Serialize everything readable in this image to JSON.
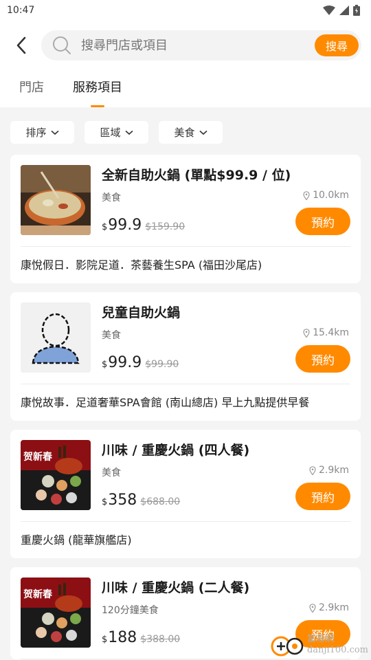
{
  "status": {
    "time": "10:47"
  },
  "search": {
    "placeholder": "搜尋門店或項目",
    "button_label": "搜尋"
  },
  "tabs": [
    {
      "label": "門店",
      "active": false
    },
    {
      "label": "服務項目",
      "active": true
    }
  ],
  "filters": [
    {
      "label": "排序"
    },
    {
      "label": "區域"
    },
    {
      "label": "美食"
    }
  ],
  "cards": [
    {
      "title": "全新自助火鍋 (單點$99.9 / 位)",
      "category": "美食",
      "distance": "10.0km",
      "currency": "$",
      "price": "99.9",
      "original_price": "$159.90",
      "book_label": "預約",
      "store": "康悅假日．影院足道．茶藝養生SPA (福田沙尾店)"
    },
    {
      "title": "兒童自助火鍋",
      "category": "美食",
      "distance": "15.4km",
      "currency": "$",
      "price": "99.9",
      "original_price": "$99.90",
      "book_label": "預約",
      "store": "康悅故事．足道奢華SPA會館 (南山總店) 早上九點提供早餐"
    },
    {
      "title": "川味 / 重慶火鍋 (四人餐)",
      "category": "美食",
      "distance": "2.9km",
      "currency": "$",
      "price": "358",
      "original_price": "$688.00",
      "book_label": "預約",
      "store": "重慶火鍋 (龍華旗艦店)",
      "banner_text": "贺新春"
    },
    {
      "title": "川味 / 重慶火鍋 (二人餐)",
      "category": "120分鐘美食",
      "distance": "2.9km",
      "currency": "$",
      "price": "188",
      "original_price": "$388.00",
      "book_label": "預約",
      "banner_text": "贺新春"
    }
  ],
  "watermark": {
    "site_cn": "當易網",
    "site_url": "danji100.com"
  },
  "colors": {
    "accent": "#ff8a00"
  }
}
